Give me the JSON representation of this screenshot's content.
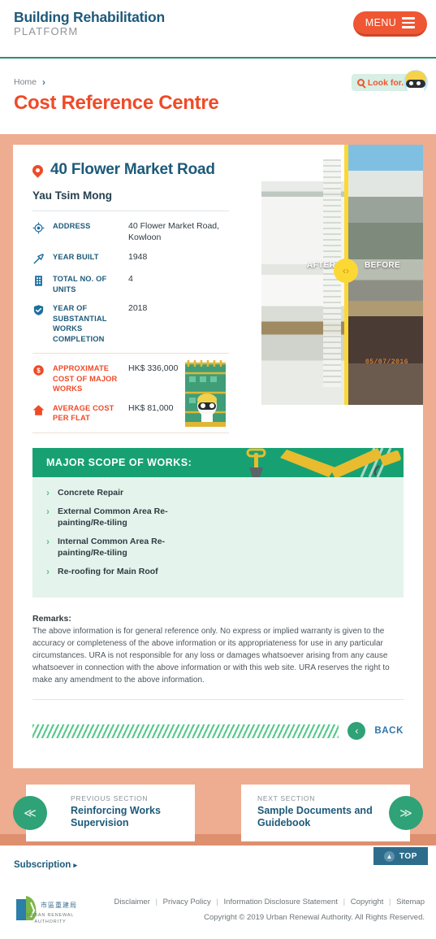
{
  "header": {
    "brand_line1": "Building Rehabilitation",
    "brand_line2": "PLATFORM",
    "menu_label": "MENU"
  },
  "breadcrumb": {
    "home": "Home",
    "separator": "›"
  },
  "page_title": "Cost Reference Centre",
  "search": {
    "label": "Look for...",
    "icon": "search-icon"
  },
  "property": {
    "name": "40 Flower Market Road",
    "district": "Yau Tsim Mong",
    "specs": [
      {
        "icon": "target-icon",
        "label": "ADDRESS",
        "value": "40 Flower Market Road, Kowloon"
      },
      {
        "icon": "hammer-icon",
        "label": "YEAR BUILT",
        "value": "1948"
      },
      {
        "icon": "building-icon",
        "label": "TOTAL NO. OF UNITS",
        "value": "4"
      },
      {
        "icon": "shield-check-icon",
        "label": "YEAR OF SUBSTANTIAL WORKS COMPLETION",
        "value": "2018"
      }
    ],
    "costs": [
      {
        "icon": "dollar-icon",
        "label": "APPROXIMATE COST OF MAJOR WORKS",
        "value": "HK$ 336,000"
      },
      {
        "icon": "home-icon",
        "label": "AVERAGE COST PER FLAT",
        "value": "HK$ 81,000"
      }
    ]
  },
  "comparison": {
    "after_label": "AFTER",
    "before_label": "BEFORE",
    "photo_date": "05/07/2016",
    "handle_icon": "slider-handle-icon"
  },
  "scope": {
    "heading": "MAJOR SCOPE OF WORKS:",
    "items": [
      "Concrete Repair",
      "External Common Area Re-painting/Re-tiling",
      "Internal Common Area Re-painting/Re-tiling",
      "Re-roofing for Main Roof"
    ]
  },
  "remarks": {
    "heading": "Remarks:",
    "body": "The above information is for general reference only. No express or implied warranty is given to the accuracy or completeness of the above information or its appropriateness for use in any particular circumstances. URA is not responsible for any loss or damages whatsoever arising from any cause whatsoever in connection with the above information or with this web site. URA reserves the right to make any amendment to the above information."
  },
  "back": {
    "label": "BACK",
    "icon": "chevron-left-icon"
  },
  "nav": {
    "prev": {
      "kicker": "PREVIOUS SECTION",
      "title": "Reinforcing Works Supervision",
      "icon": "double-chevron-left-icon"
    },
    "next": {
      "kicker": "NEXT SECTION",
      "title": "Sample Documents and Guidebook",
      "icon": "double-chevron-right-icon"
    }
  },
  "top_button": {
    "label": "TOP",
    "icon": "chevron-up-icon"
  },
  "footer": {
    "subscription": "Subscription",
    "subscription_arrow": "▸",
    "logo_cn": "市區重建局",
    "logo_en": "URBAN RENEWAL\nAUTHORITY",
    "links": [
      "Disclaimer",
      "Privacy Policy",
      "Information Disclosure Statement",
      "Copyright",
      "Sitemap"
    ],
    "copyright": "Copyright © 2019 Urban Renewal Authority. All Rights Reserved."
  },
  "colors": {
    "brand_blue": "#1d5a7a",
    "accent_orange": "#ef4a27",
    "menu_orange": "#ef5633",
    "green": "#17a173",
    "peach": "#eeac90",
    "scope_bg": "#e4f4ec",
    "top_blue": "#2e6c8c"
  }
}
